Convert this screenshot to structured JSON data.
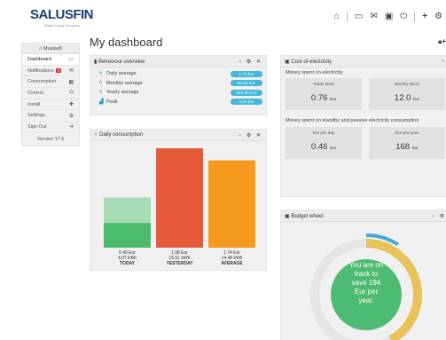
{
  "app": {
    "logo_text": "SALUSFIN",
    "logo_tagline": "Smart Living Company",
    "page_title": "My dashboard"
  },
  "top_icons": [
    "home-icon",
    "monitor-icon",
    "mail-icon",
    "image-icon",
    "power-icon",
    "plus-icon",
    "gear-icon"
  ],
  "sidebar": {
    "user": "Muaiaa5",
    "items": [
      {
        "label": "Dashboard",
        "icon": "monitor-icon",
        "active": true
      },
      {
        "label": "Notifications",
        "icon": "mail-icon",
        "badge": "0"
      },
      {
        "label": "Consumption",
        "icon": "chart-icon"
      },
      {
        "label": "Control",
        "icon": "power-icon"
      },
      {
        "label": "Install",
        "icon": "plus-icon"
      },
      {
        "label": "Settings",
        "icon": "gear-icon"
      },
      {
        "label": "Sign Out",
        "icon": "signout-icon"
      }
    ],
    "version": "Version 17.5"
  },
  "behaviour": {
    "title": "Behaviour overview",
    "rows": [
      {
        "label": "Daily average",
        "value": "1.73 Eur",
        "icon": "bolt-icon"
      },
      {
        "label": "Monthly average",
        "value": "51.84 Eur",
        "icon": "bolt-icon"
      },
      {
        "label": "Yearly average",
        "value": "622.08 Eur",
        "icon": "bolt-icon"
      },
      {
        "label": "Peak",
        "value": "0.25 Eur",
        "icon": "bar-icon"
      }
    ]
  },
  "daily": {
    "title": "Daily consumption"
  },
  "chart_data": {
    "type": "bar",
    "categories": [
      "TODAY",
      "YESTERDAY",
      "AVERAGE"
    ],
    "values": [
      0.49,
      1.98,
      1.74
    ],
    "eur_labels": [
      "0.49 Eur",
      "1.98 Eur",
      "1.74 Eur"
    ],
    "kwh_labels": [
      "4.07 kWh",
      "16.51 kWh",
      "14.48 kWh"
    ],
    "today_projection": 1.0,
    "colors": {
      "today": "#4cbb6c",
      "today_projection": "#a6dbb3",
      "yesterday": "#e55b3a",
      "average": "#f59a1d"
    }
  },
  "cost": {
    "title": "Cost of electricity",
    "spent_label": "Money spent on electricity",
    "today_label": "Today (Eur)",
    "today_value": "0.76",
    "weekly_label": "Weekly (Eur)",
    "weekly_value": "12.0",
    "standby_label": "Money spent on standby and passive electricity consumption",
    "day_label": "Eur per day",
    "day_value": "0.46",
    "year_label": "Eur per year",
    "year_value": "168",
    "unit": "Eur"
  },
  "budget": {
    "title": "Budget wheel",
    "line1": "You are on",
    "line2": "track to",
    "line3": "save 194",
    "line4": "Eur per",
    "line5": "year.",
    "budget_fraction": 0.42,
    "usage_fraction": 0.09,
    "colors": {
      "ring_bg": "#e5e5e5",
      "used": "#e8c35a",
      "blue": "#4aa8d8",
      "center": "#4ebb72"
    }
  },
  "panel_controls": "− ⚙ ✕"
}
